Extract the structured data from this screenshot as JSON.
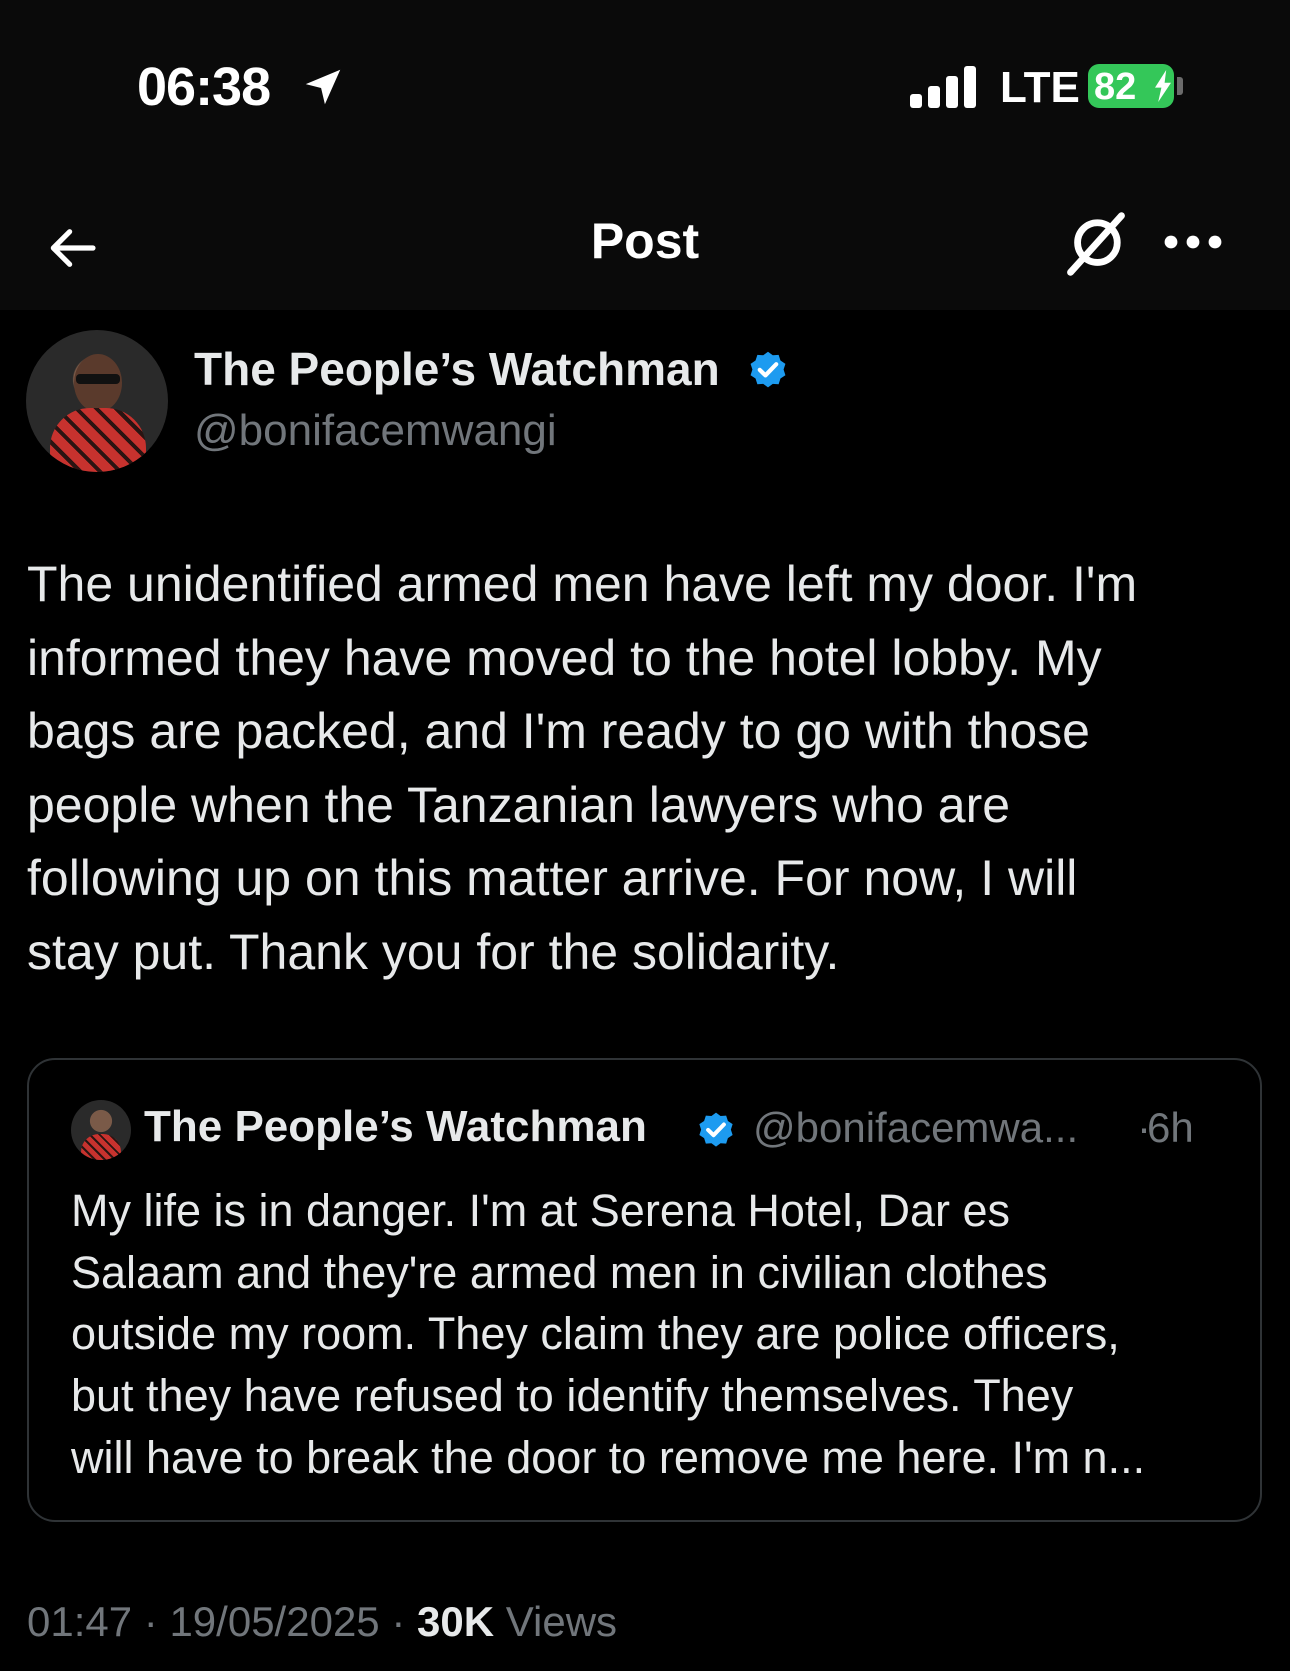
{
  "status_bar": {
    "time": "06:38",
    "network": "LTE",
    "battery": "82",
    "battery_level_percent": 82,
    "battery_color": "#34c759",
    "location_icon": "location-arrow-icon",
    "signal_icon": "signal-bars-icon"
  },
  "nav": {
    "title": "Post",
    "back_icon": "back-arrow-icon",
    "grok_icon": "grok-icon",
    "more_icon": "more-dots-icon"
  },
  "post": {
    "author": {
      "name": "The People’s Watchman",
      "handle": "@bonifacemwangi",
      "verified": true,
      "verified_color": "#1d9bf0"
    },
    "text": "The unidentified armed men have left my door. I'm\ninformed they have moved to the hotel lobby. My\nbags are packed, and I'm ready to go with those\npeople when the Tanzanian lawyers who are\nfollowing up on this matter arrive. For now, I will\nstay put. Thank you for the solidarity.",
    "quote": {
      "author_name": "The People’s Watchman",
      "author_handle": "@bonifacemwa...",
      "separator": "·",
      "time": "6h",
      "text": "My life is in danger. I'm at Serena Hotel, Dar es\nSalaam and they're armed men in civilian clothes\noutside my room. They claim they are police officers,\nbut they have refused to identify themselves. They\nwill have to break the door to remove me here. I'm n..."
    },
    "meta": {
      "time": "01:47",
      "date": "19/05/2025",
      "separator": "·",
      "views_count": "30K",
      "views_label": "Views"
    }
  }
}
